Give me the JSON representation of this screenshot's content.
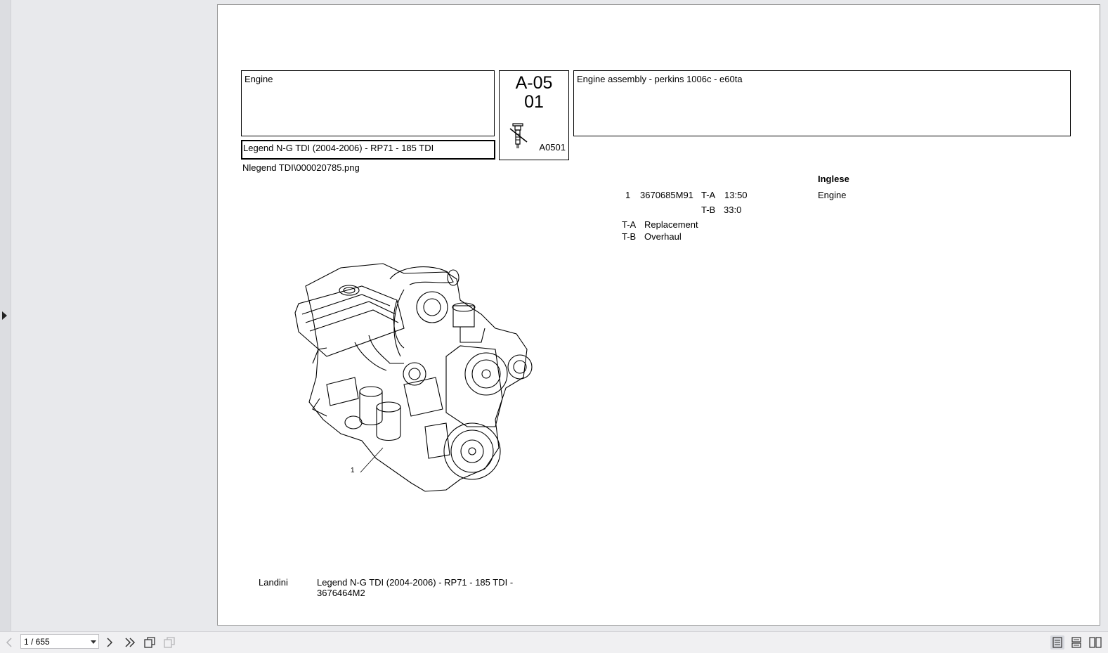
{
  "document": {
    "group_title": "Engine",
    "model": "Legend N-G TDI (2004-2006) - RP71 - 185 TDI",
    "section_code_line1": "A-05",
    "section_code_line2": "01",
    "section_ref": "A0501",
    "assembly_title": "Engine assembly - perkins 1006c - e60ta",
    "image_path": "Nlegend TDI\\000020785.png",
    "language_header": "Inglese",
    "parts": [
      {
        "ref": "1",
        "part_number": "3670685M91",
        "ta_code": "T-A",
        "ta_value": "13:50",
        "tb_code": "T-B",
        "tb_value": "33:0",
        "description": "Engine"
      }
    ],
    "legend": [
      {
        "code": "T-A",
        "meaning": "Replacement"
      },
      {
        "code": "T-B",
        "meaning": "Overhaul"
      }
    ],
    "drawing_callout": "1",
    "footer_brand": "Landini",
    "footer_model_line1": "Legend N-G TDI (2004-2006) - RP71 - 185 TDI -",
    "footer_model_line2": "3676464M2"
  },
  "viewer": {
    "page_indicator": "1 / 655"
  }
}
